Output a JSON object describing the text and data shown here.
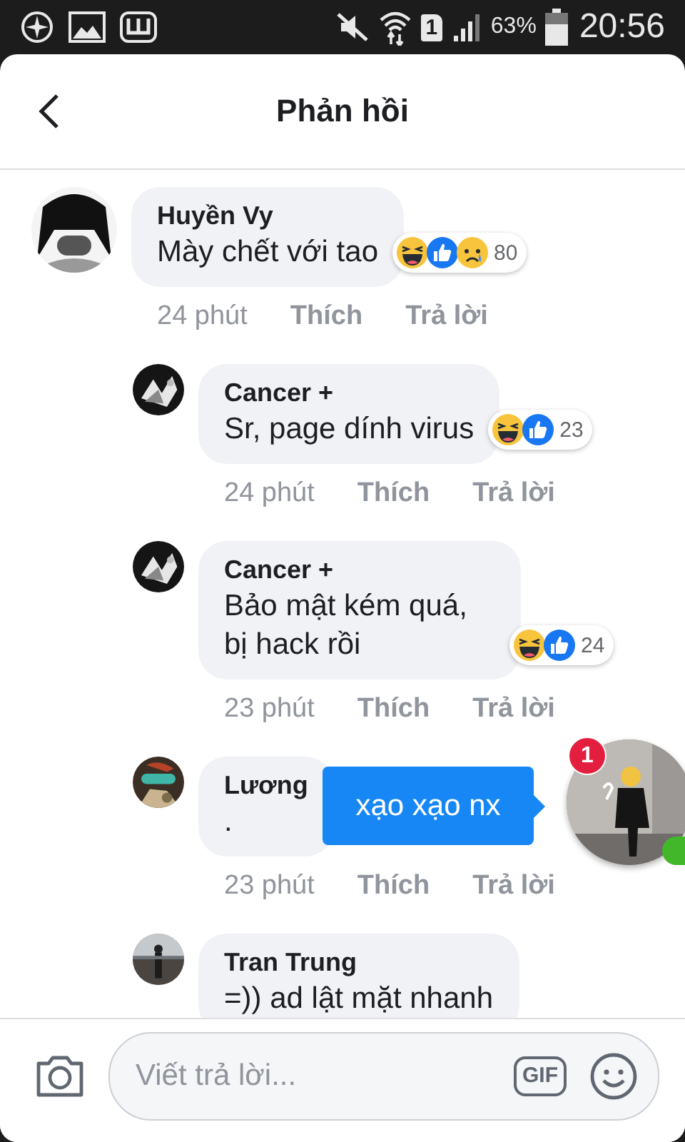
{
  "status_bar": {
    "sim_slot": "1",
    "battery": "63%",
    "time": "20:56"
  },
  "header": {
    "title": "Phản hồi"
  },
  "comments": [
    {
      "name": "Huyền Vy",
      "text": "Mày chết với tao",
      "reactions": [
        {
          "kind": "haha"
        },
        {
          "kind": "like"
        },
        {
          "kind": "sad"
        }
      ],
      "reaction_count": "80",
      "time": "24 phút",
      "like": "Thích",
      "reply": "Trả lời",
      "children": [
        {
          "name": "Cancer +",
          "text": "Sr, page dính virus",
          "reactions": [
            {
              "kind": "haha"
            },
            {
              "kind": "like"
            }
          ],
          "reaction_count": "23",
          "time": "24 phút",
          "like": "Thích",
          "reply": "Trả lời"
        },
        {
          "name": "Cancer +",
          "text": "Bảo mật kém quá, bị hack rồi",
          "reactions": [
            {
              "kind": "haha"
            },
            {
              "kind": "like"
            }
          ],
          "reaction_count": "24",
          "time": "23 phút",
          "like": "Thích",
          "reply": "Trả lời"
        },
        {
          "name": "Lương",
          "text": ".",
          "time": "23 phút",
          "like": "Thích",
          "reply": "Trả lời"
        },
        {
          "name": "Tran Trung",
          "text": "=)) ad lật mặt nhanh"
        }
      ]
    }
  ],
  "chat_head": {
    "badge": "1",
    "message": "xạo xạo nx",
    "online": true
  },
  "composer": {
    "placeholder": "Viết trả lời...",
    "gif": "GIF"
  }
}
